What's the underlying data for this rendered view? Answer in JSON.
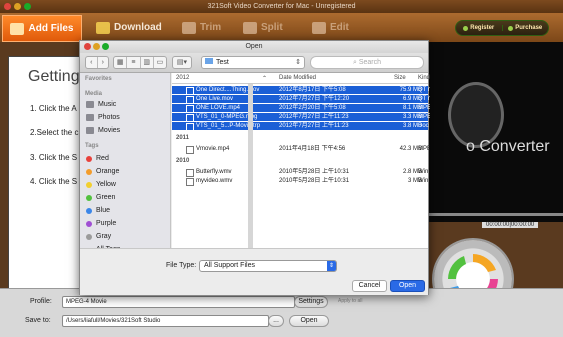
{
  "window": {
    "title": "321Soft Video Converter for Mac - Unregistered"
  },
  "toolbar": {
    "add_files": "Add Files",
    "download": "Download",
    "trim": "Trim",
    "split": "Split",
    "edit": "Edit",
    "register": "Register",
    "purchase": "Purchase"
  },
  "getting_started": {
    "title": "Getting",
    "steps": [
      "1. Click the A",
      "2.Select the c",
      "3. Click the S",
      "4. Click the S"
    ]
  },
  "preview": {
    "overlay_text": "o Converter",
    "time": "00:00:00|00:00:00"
  },
  "bottom": {
    "profile_label": "Profile:",
    "profile_value": "MPEG-4 Movie",
    "settings": "Settings",
    "apply_all": "Apply to all",
    "saveto_label": "Save to:",
    "saveto_value": "/Users/liafull/Movies/321Soft Studio",
    "browse": "...",
    "open": "Open"
  },
  "dialog": {
    "title": "Open",
    "path": "Test",
    "search_placeholder": "Search",
    "sidebar": {
      "favorites_header": "Favorites",
      "media_header": "Media",
      "media": [
        "Music",
        "Photos",
        "Movies"
      ],
      "tags_header": "Tags",
      "tags": [
        {
          "label": "Red",
          "color": "#e8413b"
        },
        {
          "label": "Orange",
          "color": "#f39c2b"
        },
        {
          "label": "Yellow",
          "color": "#f2cf2f"
        },
        {
          "label": "Green",
          "color": "#52c13f"
        },
        {
          "label": "Blue",
          "color": "#3b86e8"
        },
        {
          "label": "Purple",
          "color": "#a04fd3"
        },
        {
          "label": "Gray",
          "color": "#9b9b9b"
        },
        {
          "label": "All Tags...",
          "color": ""
        }
      ]
    },
    "columns": {
      "name": "2012",
      "date": "Date Modified",
      "size": "Size",
      "kind": "Kind"
    },
    "groups": [
      {
        "label": "2012",
        "files": [
          {
            "name": "One Direct....Thing.mov",
            "date": "2012年8月17日 下午5:08",
            "size": "75.9 MB",
            "kind": "QT n",
            "selected": true
          },
          {
            "name": "One Live.mov",
            "date": "2012年7月27日 下午12:20",
            "size": "6.9 MB",
            "kind": "QT n",
            "selected": true
          },
          {
            "name": "ONE LOVE.mp4",
            "date": "2012年2月20日 下午5:08",
            "size": "8.1 MB",
            "kind": "MPE",
            "selected": true
          },
          {
            "name": "VTS_01_0-MPEG.mpg",
            "date": "2012年7月27日 上午11:23",
            "size": "3.3 MB",
            "kind": "MPE",
            "selected": true
          },
          {
            "name": "VTS_01_5...P-Movie.trp",
            "date": "2012年7月27日 上午11:23",
            "size": "3.8 MB",
            "kind": "Doc",
            "selected": true
          }
        ]
      },
      {
        "label": "2011",
        "files": [
          {
            "name": "Vmovie.mp4",
            "date": "2011年4月18日 下午4:56",
            "size": "42.3 MB",
            "kind": "MPE",
            "selected": false
          }
        ]
      },
      {
        "label": "2010",
        "files": [
          {
            "name": "Butterfly.wmv",
            "date": "2010年5月28日 上午10:31",
            "size": "2.8 MB",
            "kind": "Win",
            "selected": false
          },
          {
            "name": "myvideo.wmv",
            "date": "2010年5月28日 上午10:31",
            "size": "3 MB",
            "kind": "Win",
            "selected": false
          }
        ]
      }
    ],
    "file_type_label": "File Type:",
    "file_type_value": "All Support Files",
    "cancel": "Cancel",
    "open": "Open"
  }
}
